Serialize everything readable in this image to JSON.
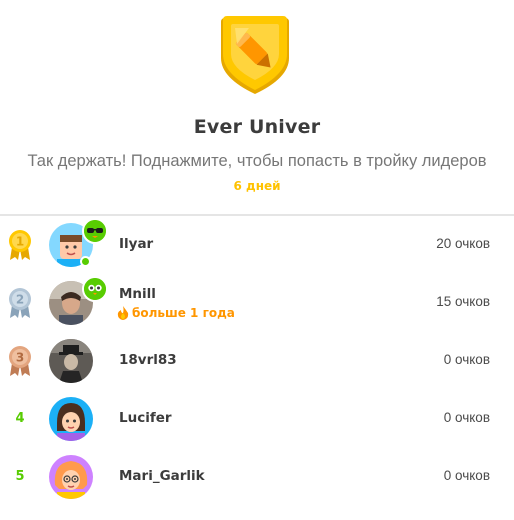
{
  "league": {
    "title": "Ever Univer",
    "subtitle": "Так держать! Поднажмите, чтобы попасть в тройку лидеров",
    "days_left": "6 дней"
  },
  "leaderboard": [
    {
      "rank": "1",
      "name": "Ilyar",
      "xp": "20 очков",
      "streak": "",
      "medal": "gold"
    },
    {
      "rank": "2",
      "name": "Mnill",
      "xp": "15 очков",
      "streak": "больше 1 года",
      "medal": "silver"
    },
    {
      "rank": "3",
      "name": "18vrl83",
      "xp": "0 очков",
      "streak": "",
      "medal": "bronze"
    },
    {
      "rank": "4",
      "name": "Lucifer",
      "xp": "0 очков",
      "streak": "",
      "medal": ""
    },
    {
      "rank": "5",
      "name": "Mari_Garlik",
      "xp": "0 очков",
      "streak": "",
      "medal": ""
    }
  ],
  "colors": {
    "accent_green": "#58cc02",
    "gold": "#ffc800",
    "silver": "#b2c5d6",
    "bronze": "#e3a57f",
    "streak_orange": "#ff9600",
    "days_yellow": "#ffc200"
  },
  "icons": {
    "league": "pencil-shield-badge-icon",
    "streak": "fire-icon",
    "rank_medals": [
      "gold-medal-icon",
      "silver-medal-icon",
      "bronze-medal-icon"
    ]
  }
}
